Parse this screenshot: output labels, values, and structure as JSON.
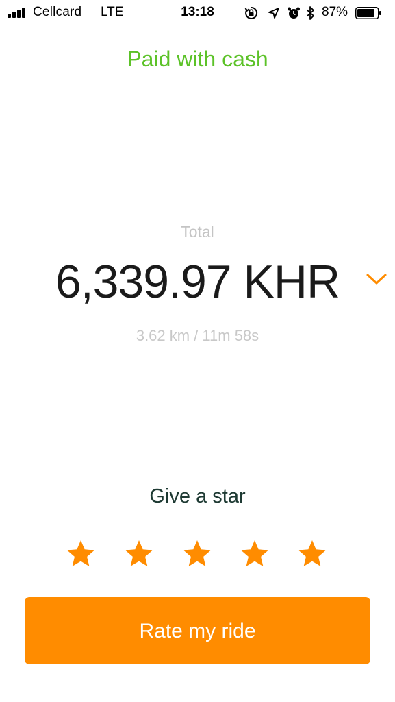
{
  "status_bar": {
    "carrier": "Cellcard",
    "network": "LTE",
    "time": "13:18",
    "battery_percent": "87%",
    "icons": [
      "signal-icon",
      "orientation-lock-icon",
      "location-arrow-icon",
      "alarm-icon",
      "bluetooth-icon",
      "battery-icon"
    ]
  },
  "header": {
    "payment_status": "Paid with cash"
  },
  "fare": {
    "total_label": "Total",
    "amount": "6,339.97 KHR",
    "trip_stats": "3.62 km / 11m 58s"
  },
  "rating": {
    "prompt": "Give a star",
    "star_count": 5,
    "star_color": "#ff8c00"
  },
  "actions": {
    "rate_label": "Rate my ride"
  },
  "colors": {
    "accent": "#ff8c00",
    "paid_green": "#5cc228",
    "prompt_dark": "#1e3a33"
  }
}
